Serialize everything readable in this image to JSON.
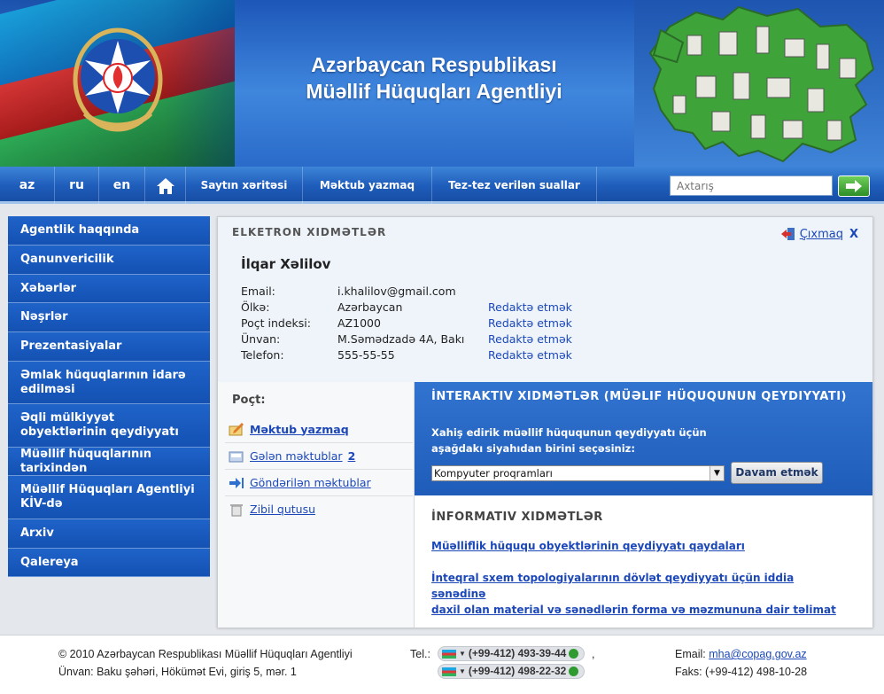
{
  "header": {
    "title_line1": "Azərbaycan Respublikası",
    "title_line2": "Müəllif Hüquqları Agentliyi"
  },
  "nav": {
    "languages": [
      "az",
      "ru",
      "en"
    ],
    "links": [
      "Saytın xəritəsi",
      "Məktub yazmaq",
      "Tez-tez verilən suallar"
    ],
    "search_placeholder": "Axtarış"
  },
  "sidebar": {
    "items": [
      "Agentlik haqqında",
      "Qanunvericilik",
      "Xəbərlər",
      "Nəşrlər",
      "Prezentasiyalar",
      "Əmlak hüquqlarının idarə edilməsi",
      "Əqli mülkiyyət obyektlərinin qeydiyyatı",
      "Müəllif hüquqlarının tarixindən",
      "Müəllif Hüquqları Agentliyi KİV-də",
      "Arxiv",
      "Qalereya"
    ]
  },
  "eservices": {
    "title": "ELKETRON XIDMƏTLƏR",
    "logout_label": "Çıxmaq",
    "logout_x": "X",
    "user_name": "İlqar Xəlilov",
    "profile": [
      {
        "label": "Email:",
        "value": "i.khalilov@gmail.com",
        "edit": ""
      },
      {
        "label": "Ölkə:",
        "value": "Azərbaycan",
        "edit": "Redaktə etmək"
      },
      {
        "label": "Poçt indeksi:",
        "value": "AZ1000",
        "edit": "Redaktə etmək"
      },
      {
        "label": "Ünvan:",
        "value": "M.Səmədzadə 4A, Bakı",
        "edit": "Redaktə etmək"
      },
      {
        "label": "Telefon:",
        "value": "555-55-55",
        "edit": "Redaktə etmək"
      }
    ]
  },
  "mail": {
    "title": "Poçt:",
    "compose": "Məktub yazmaq",
    "inbox": "Gələn məktublar",
    "inbox_count": "2",
    "sent": "Göndərilən məktublar",
    "trash": "Zibil qutusu"
  },
  "interactive": {
    "title": "İNTERAKTIV XIDMƏTLƏR (MÜƏLIF HÜQUQUNUN QEYDIYYATI)",
    "text_line1": "Xahiş edirik müəllif hüququnun qeydiyyatı üçün",
    "text_line2": "aşağdakı siyahıdan birini seçəsiniz:",
    "select_value": "Kompyuter proqramları",
    "continue_label": "Davam etmək"
  },
  "informative": {
    "title": "İNFORMATIV XIDMƏTLƏR",
    "link1": "Müəlliflik hüququ obyektlərinin qeydiyyatı qaydaları",
    "link2_line1": "İnteqral sxem topologiyalarının dövlət qeydiyyatı üçün iddia sənədinə",
    "link2_line2": "daxil olan material və sənədlərin forma və məzmununa dair təlimat"
  },
  "footer": {
    "copyright": "© 2010 Azərbaycan Respublikası Müəllif Hüquqları Agentliyi",
    "address": "Ünvan: Baku şəhəri, Hökümət Evi, giriş 5, mər. 1",
    "tel_label": "Tel.:",
    "phone1": "(+99-412) 493-39-44",
    "phone_sep": ",",
    "phone2": "(+99-412) 498-22-32",
    "email_label": "Email:",
    "email": "mha@copag.gov.az",
    "fax": "Faks: (+99-412) 498-10-28"
  },
  "colors": {
    "brand_blue": "#1f5dbb",
    "link_blue": "#1b47b8",
    "flag_blue": "#1aa7e6",
    "flag_red": "#e03838",
    "flag_green": "#2fb35a"
  }
}
